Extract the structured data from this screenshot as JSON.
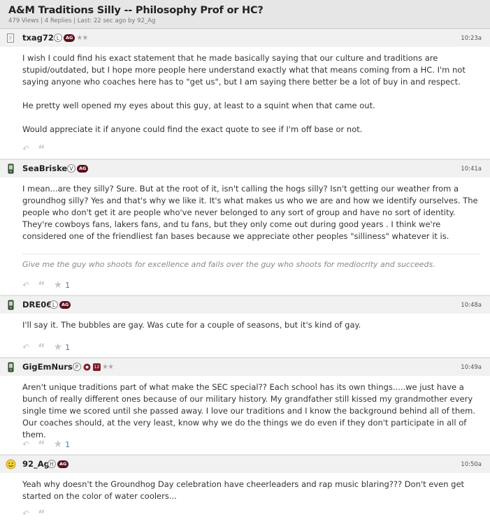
{
  "thread": {
    "title": "A&M Traditions Silly -- Philosophy Prof or HC?",
    "meta": "479 Views | 4 Replies | Last: 22 sec ago by 92_Ag"
  },
  "posts": [
    {
      "username": "txag72",
      "badges": [
        "L",
        "AG",
        "★★"
      ],
      "time": "10:23a",
      "paragraphs": [
        "I wish I could find his exact statement that he made basically saying that our culture and traditions are stupid/outdated, but I hope more people here understand exactly what that means coming from a HC. I'm not saying anyone who coaches here has to \"get us\", but I am saying there better be a lot of buy in and respect.",
        "He pretty well opened my eyes about this guy, at least to a squint when that came out.",
        "Would appreciate it if anyone could find the exact quote to see if I'm off base or not."
      ],
      "likes": ""
    },
    {
      "username": "SeaBrisket",
      "badges": [
        "V",
        "AG"
      ],
      "time": "10:41a",
      "paragraphs": [
        "I mean...are they silly? Sure. But at the root of it, isn't calling the hogs silly? Isn't getting our weather from a groundhog silly? Yes and that's why we like it. It's what makes us who we are and how we identify ourselves. The people who don't get it are people who've never belonged to any sort of group and have no sort of identity. They're cowboys fans, lakers fans, and tu fans, but they only come out during good years . I think we're considered one of the friendliest fan bases because we appreciate other peoples \"silliness\" whatever it is."
      ],
      "signature": "Give me the guy who shoots for excellence and fails over the guy who shoots for mediocrity and succeeds.",
      "likes": "1"
    },
    {
      "username": "DRE06",
      "badges": [
        "L",
        "AG"
      ],
      "time": "10:48a",
      "paragraphs": [
        "I'll say it. The bubbles are gay. Was cute for a couple of seasons, but it's kind of gay."
      ],
      "likes": "1"
    },
    {
      "username": "GigEmNurse",
      "badges": [
        "P",
        "12",
        "★★"
      ],
      "time": "10:49a",
      "paragraphs": [
        "Aren't unique traditions part of what make the SEC special?? Each school has its own things.....we just have a bunch of really different ones because of our military history. My grandfather still kissed my grandmother every single time we scored until she passed away. I love our traditions and I know the background behind all of them. Our coaches should, at the very least, know why we do the things we do even if they don't participate in all of them."
      ],
      "likes": "1"
    },
    {
      "username": "92_Ag",
      "badges": [
        "H",
        "AG"
      ],
      "time": "10:50a",
      "paragraphs": [
        "Yeah why doesn't the Groundhog Day celebration have cheerleaders and rap music blaring??? Don't even get started on the color of water coolers..."
      ],
      "likes": ""
    }
  ],
  "colors": {
    "accent": "#5a0e1a",
    "link": "#4a78b5",
    "header_bg": "#e6e6e6",
    "post_head_bg": "#f1f1f1"
  },
  "icons": [
    "reply-icon",
    "quote-icon",
    "star-icon",
    "document-icon",
    "phone-icon",
    "smiley-icon"
  ]
}
